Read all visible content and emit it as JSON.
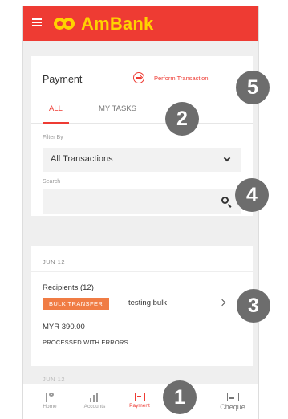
{
  "brand": {
    "name": "AmBank",
    "header_color": "#ee3b33",
    "logo_color": "#ffd200"
  },
  "payment": {
    "title": "Payment",
    "perform_label": "Perform Transaction",
    "tabs": [
      {
        "label": "ALL"
      },
      {
        "label": "MY TASKS"
      }
    ],
    "filter_label": "Filter By",
    "filter_value": "All Transactions",
    "search_label": "Search"
  },
  "transactions": {
    "date": "JUN 12",
    "items": [
      {
        "recipients": "Recipients (12)",
        "badge": "BULK TRANSFER",
        "description": "testing bulk",
        "amount": "MYR 390.00",
        "status": "PROCESSED WITH ERRORS"
      }
    ],
    "next_date": "JUN 12"
  },
  "nav": {
    "items": [
      {
        "label": "Home",
        "icon": "home-icon"
      },
      {
        "label": "Accounts",
        "icon": "accounts-icon"
      },
      {
        "label": "Payment",
        "icon": "payment-icon"
      },
      {
        "label": "Cheque",
        "icon": "cheque-icon"
      }
    ]
  },
  "callouts": [
    "1",
    "2",
    "3",
    "4",
    "5"
  ]
}
